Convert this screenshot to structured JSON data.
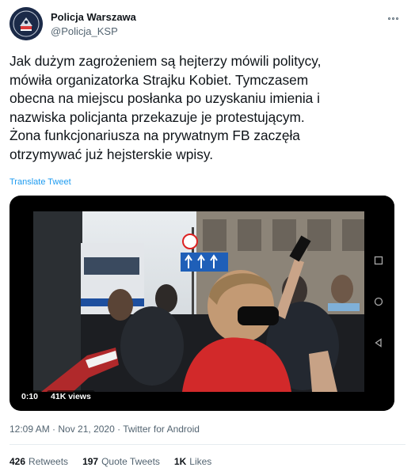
{
  "author": {
    "display_name": "Policja Warszawa",
    "handle": "@Policja_KSP",
    "avatar_text": "POLICJA"
  },
  "tweet": {
    "text": "Jak dużym zagrożeniem są hejterzy mówili politycy,\nmówiła organizatorka Strajku Kobiet. Tymczasem\nobecna na miejscu posłanka po uzyskaniu imienia i\nnazwiska policjanta przekazuje je protestującym.\nŻona funkcjonariusza na prywatnym FB zaczęła\notrzymywać już hejsterskie wpisy.",
    "translate_label": "Translate Tweet"
  },
  "video": {
    "time": "0:10",
    "views": "41K views"
  },
  "meta": {
    "time": "12:09 AM",
    "separator": " · ",
    "date": "Nov 21, 2020",
    "source": "Twitter for Android"
  },
  "stats": {
    "retweets_count": "426",
    "retweets_label": "Retweets",
    "quotes_count": "197",
    "quotes_label": "Quote Tweets",
    "likes_count": "1K",
    "likes_label": "Likes"
  },
  "colors": {
    "link": "#1d9bf0",
    "secondary_text": "#536471",
    "primary_text": "#0f1419"
  }
}
